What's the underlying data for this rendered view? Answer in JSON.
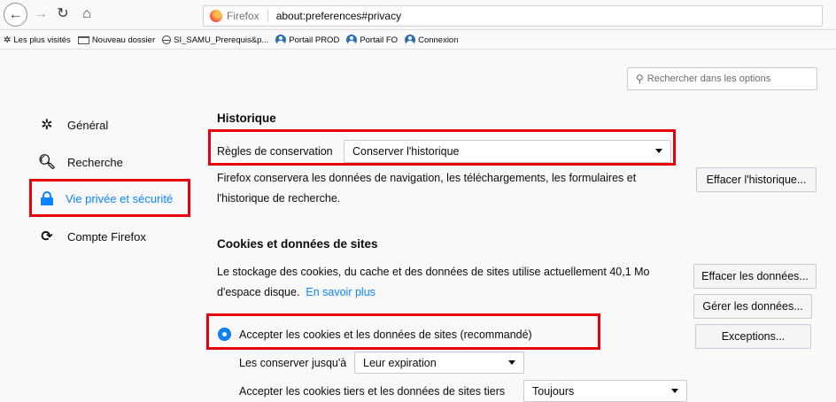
{
  "toolbar": {
    "url_brand": "Firefox",
    "url": "about:preferences#privacy"
  },
  "bookmarks": [
    {
      "label": "Les plus visités",
      "icon": "gear-icon"
    },
    {
      "label": "Nouveau dossier",
      "icon": "folder-icon"
    },
    {
      "label": "SI_SAMU_Prerequis&p...",
      "icon": "globe-icon"
    },
    {
      "label": "Portail PROD",
      "icon": "person-icon"
    },
    {
      "label": "Portail FO",
      "icon": "person-icon"
    },
    {
      "label": "Connexion",
      "icon": "person-icon"
    }
  ],
  "search": {
    "placeholder": "Rechercher dans les options"
  },
  "sidebar": {
    "items": [
      {
        "label": "Général",
        "icon": "gear-icon"
      },
      {
        "label": "Recherche",
        "icon": "search-icon"
      },
      {
        "label": "Vie privée et sécurité",
        "icon": "lock-icon",
        "selected": true
      },
      {
        "label": "Compte Firefox",
        "icon": "sync-icon"
      }
    ]
  },
  "history": {
    "title": "Historique",
    "rules_label": "Règles de conservation",
    "rules_value": "Conserver l'historique",
    "description_line1": "Firefox conservera les données de navigation, les téléchargements, les formulaires et",
    "description_line2": "l'historique de recherche.",
    "clear_button": "Effacer l'historique..."
  },
  "cookies": {
    "title": "Cookies et données de sites",
    "description_line1": "Le stockage des cookies, du cache et des données de sites utilise actuellement 40,1 Mo",
    "description_line2": "d'espace disque.",
    "learn_more": "En savoir plus",
    "clear_data_button": "Effacer les données...",
    "manage_data_button": "Gérer les données...",
    "exceptions_button": "Exceptions...",
    "accept_label": "Accepter les cookies et les données de sites (recommandé)",
    "keep_until_label": "Les conserver jusqu'à",
    "keep_until_value": "Leur expiration",
    "third_party_label": "Accepter les cookies tiers et les données de sites tiers",
    "third_party_value": "Toujours"
  },
  "colors": {
    "accent": "#0a84ff",
    "highlight": "#e8000b"
  }
}
